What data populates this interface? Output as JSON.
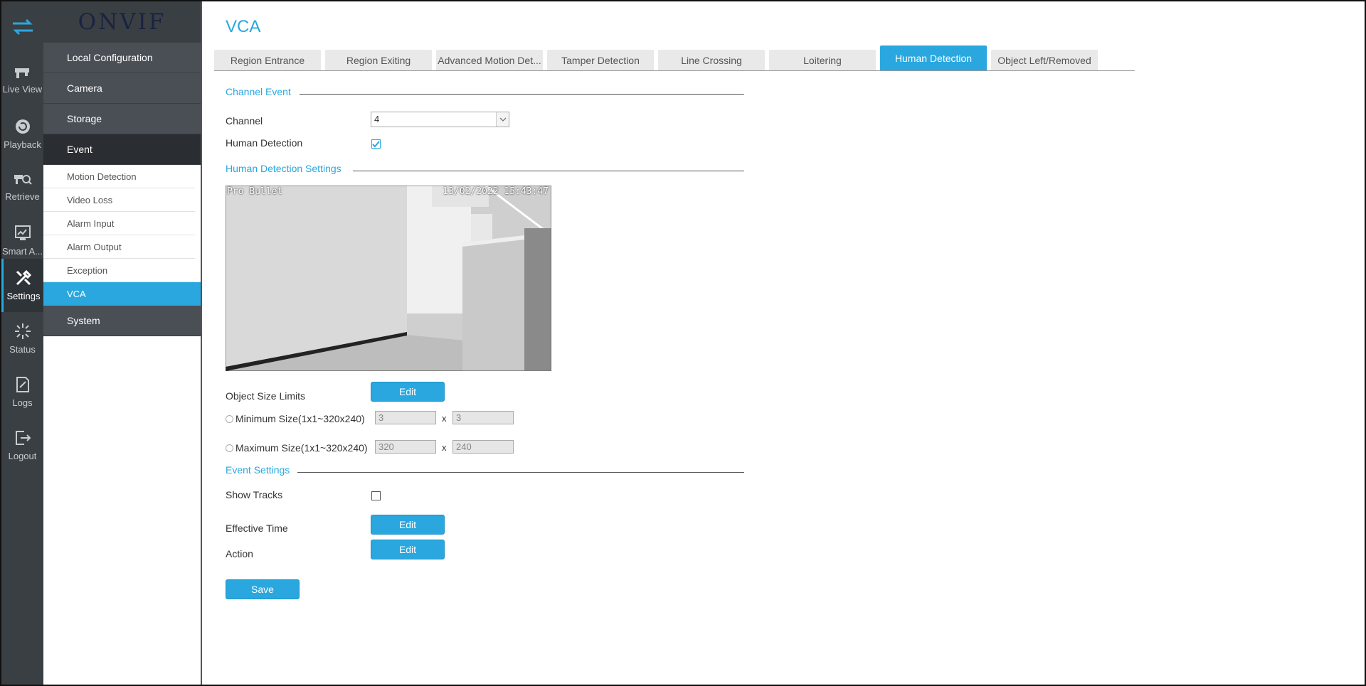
{
  "brand": {
    "logo_text": "ONVIF"
  },
  "rail": {
    "items": [
      {
        "label": "Live View",
        "icon": "live-view-icon"
      },
      {
        "label": "Playback",
        "icon": "playback-icon"
      },
      {
        "label": "Retrieve",
        "icon": "retrieve-icon"
      },
      {
        "label": "Smart A...",
        "icon": "smart-analytics-icon"
      },
      {
        "label": "Settings",
        "icon": "settings-icon"
      },
      {
        "label": "Status",
        "icon": "status-icon"
      },
      {
        "label": "Logs",
        "icon": "logs-icon"
      },
      {
        "label": "Logout",
        "icon": "logout-icon"
      }
    ]
  },
  "menu": {
    "local_configuration": "Local Configuration",
    "camera": "Camera",
    "storage": "Storage",
    "event": "Event",
    "event_items": [
      "Motion Detection",
      "Video Loss",
      "Alarm Input",
      "Alarm Output",
      "Exception",
      "VCA"
    ],
    "system": "System"
  },
  "page": {
    "title": "VCA"
  },
  "tabs": [
    "Region Entrance",
    "Region Exiting",
    "Advanced Motion Det...",
    "Tamper Detection",
    "Line Crossing",
    "Loitering",
    "Human Detection",
    "Object Left/Removed"
  ],
  "active_tab": "Human Detection",
  "channel_event": {
    "title": "Channel Event",
    "channel_label": "Channel",
    "channel_value": "4",
    "human_detection_label": "Human Detection",
    "human_detection_checked": true
  },
  "settings": {
    "title": "Human Detection Settings",
    "preview_osd_name": "Pro Bullet",
    "preview_osd_time": "13/02/2022  15:43:47",
    "object_size_label": "Object Size Limits",
    "edit_label": "Edit",
    "min_label": "Minimum Size(1x1~320x240)",
    "min_w": "3",
    "min_h": "3",
    "max_label": "Maximum Size(1x1~320x240)",
    "max_w": "320",
    "max_h": "240",
    "x_sep": "x"
  },
  "event_settings": {
    "title": "Event Settings",
    "show_tracks_label": "Show Tracks",
    "show_tracks_checked": false,
    "effective_time_label": "Effective Time",
    "action_label": "Action",
    "edit_label": "Edit"
  },
  "save_label": "Save",
  "colors": {
    "accent": "#2aa7df",
    "rail_bg": "#3a3f44",
    "menu_head_bg": "#4a4f55"
  }
}
